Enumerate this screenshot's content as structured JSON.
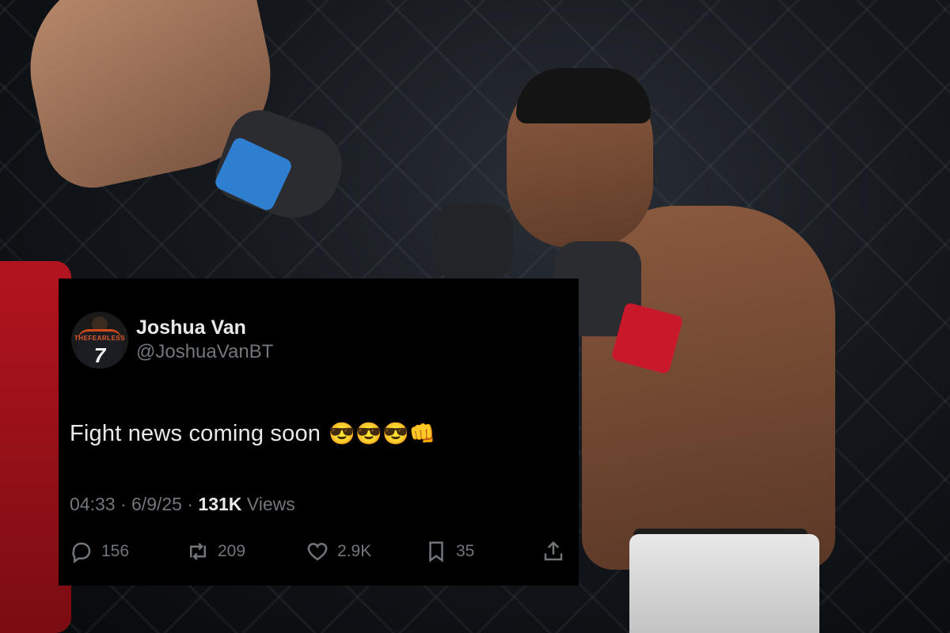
{
  "tweet": {
    "display_name": "Joshua Van",
    "handle": "@JoshuaVanBT",
    "avatar": {
      "jersey_text": "THEFEARLESS",
      "number": "7"
    },
    "text": "Fight news coming soon",
    "emojis": "😎😎😎👊",
    "time": "04:33",
    "date": "6/9/25",
    "views_count": "131K",
    "views_label": "Views",
    "actions": {
      "replies": "156",
      "reposts": "209",
      "likes": "2.9K",
      "bookmarks": "35"
    }
  },
  "icons": [
    "reply-icon",
    "repost-icon",
    "like-icon",
    "bookmark-icon",
    "share-icon"
  ],
  "colors": {
    "card_bg": "#000000",
    "text": "#e7e9ea",
    "muted": "#71767b"
  }
}
